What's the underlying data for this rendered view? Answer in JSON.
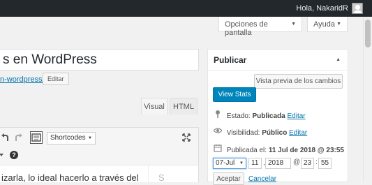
{
  "adminbar": {
    "greeting": "Hola, NakaridR"
  },
  "screen_meta": {
    "screen_options": "Opciones de pantalla",
    "help": "Ayuda"
  },
  "post": {
    "title": "s en WordPress",
    "permalink": "n-wordpress/",
    "edit_slug_label": "Editar"
  },
  "editor": {
    "tab_visual": "Visual",
    "tab_html": "HTML",
    "shortcodes_label": "Shortcodes",
    "content_text": "izarla, lo ideal hacerlo a través del",
    "side_pane_letter": "S"
  },
  "publish": {
    "title": "Publicar",
    "preview_label": "Vista previa de los cambios",
    "stats_label": "View Stats",
    "status_label": "Estado:",
    "status_value": "Publicada",
    "status_edit": "Editar",
    "visibility_label": "Visibilidad:",
    "visibility_value": "Público",
    "visibility_edit": "Editar",
    "published_label": "Publicada el:",
    "published_value": "11 Jul de 2018 @ 23:55",
    "month": "07-Jul",
    "day": "11",
    "comma": ",",
    "year": "2018",
    "at": "@",
    "hour": "23",
    "colon": ":",
    "minute": "55",
    "accept_label": "Aceptar",
    "cancel_label": "Cancelar"
  },
  "colors": {
    "admin_bar": "#23282d",
    "primary_button": "#0085ba",
    "link": "#0073aa"
  },
  "icons": [
    "user-avatar-icon",
    "undo-icon",
    "redo-icon",
    "keyboard-icon",
    "expand-icon",
    "help-icon",
    "pin-icon",
    "eye-icon",
    "calendar-icon"
  ]
}
